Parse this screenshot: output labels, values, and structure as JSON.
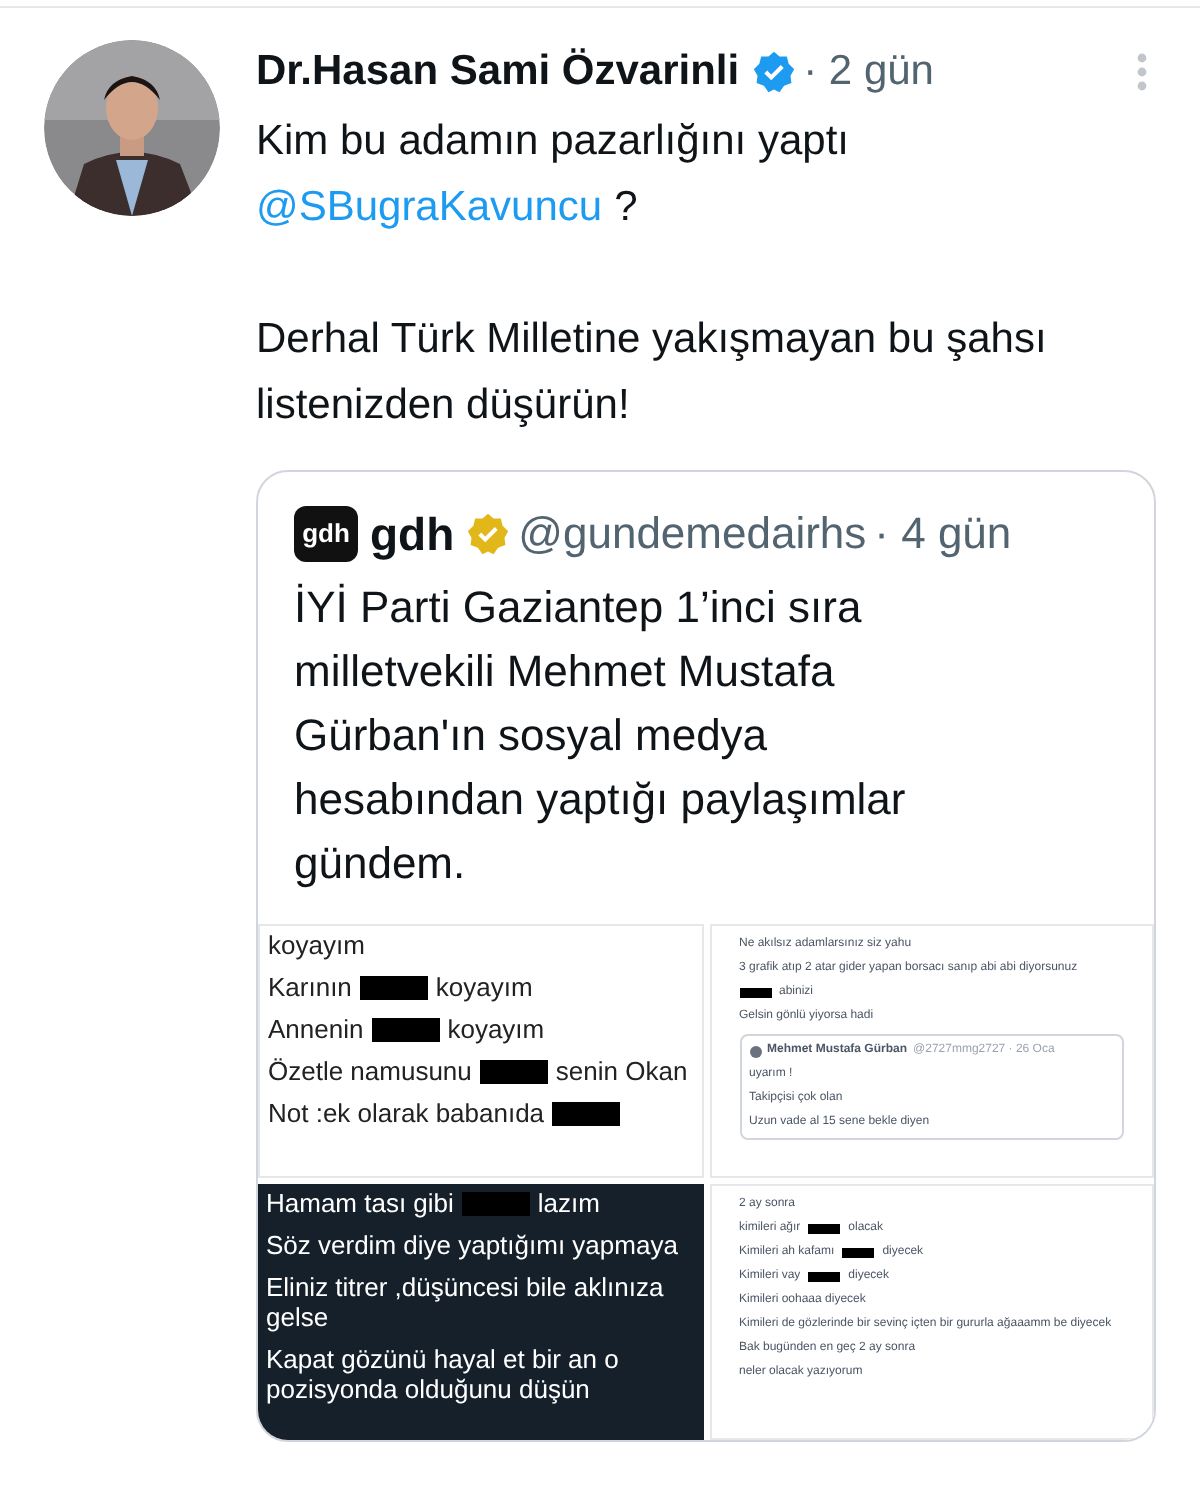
{
  "tweet": {
    "author": "Dr.Hasan Sami Özvarinli",
    "verified": true,
    "time": "· 2 gün",
    "text_lines": [
      {
        "kind": "text",
        "text": "Kim bu adamın pazarlığını yaptı"
      },
      {
        "kind": "mention",
        "text": "@SBugraKavuncu",
        "after": "?"
      },
      {
        "kind": "blank"
      },
      {
        "kind": "text",
        "text": "Derhal Türk Milletine yakışmayan bu şahsı listenizden düşürün!"
      }
    ]
  },
  "quote": {
    "logo": "gdh",
    "author": "gdh",
    "verified": true,
    "handle": "@gundemedairhs",
    "time": "· 4 gün",
    "text": "İYİ Parti Gaziantep 1’inci sıra milletvekili Mehmet Mustafa Gürban'ın sosyal medya hesabından yaptığı paylaşımlar gündem.",
    "images": [
      {
        "kind": "notes",
        "lines": [
          [
            {
              "kind": "text",
              "text": "koyayım"
            }
          ],
          [
            {
              "kind": "text",
              "text": "Karının"
            },
            {
              "kind": "redaction"
            },
            {
              "kind": "text",
              "text": "koyayım"
            }
          ],
          [
            {
              "kind": "text",
              "text": "Annenin"
            },
            {
              "kind": "redaction"
            },
            {
              "kind": "text",
              "text": "koyayım"
            }
          ],
          [
            {
              "kind": "text",
              "text": "Özetle namusunu"
            },
            {
              "kind": "redaction"
            },
            {
              "kind": "text",
              "text": "senin Okan"
            }
          ],
          [
            {
              "kind": "text",
              "text": "Not :ek olarak babanıda"
            },
            {
              "kind": "redaction"
            }
          ]
        ]
      },
      {
        "kind": "thread",
        "lines": [
          [
            {
              "kind": "text",
              "text": "Ne akılsız adamlarsınız siz yahu"
            }
          ],
          [
            {
              "kind": "text",
              "text": "3 grafik atıp 2 atar gider yapan borsacı sanıp abi abi diyorsunuz"
            }
          ],
          [
            {
              "kind": "redaction"
            },
            {
              "kind": "text",
              "text": "abinizi"
            }
          ],
          [
            {
              "kind": "text",
              "text": "Gelsin gönlü yiyorsa hadi"
            }
          ]
        ],
        "quoted": {
          "author": "Mehmet Mustafa Gürban",
          "meta": "@2727mmg2727 · 26 Oca",
          "lines": [
            "uyarım !",
            "Takipçisi çok olan",
            "Uzun vade al 15 sene bekle diyen"
          ]
        }
      },
      {
        "kind": "darknotes",
        "lines": [
          [
            {
              "kind": "text",
              "text": "Hamam tası gibi"
            },
            {
              "kind": "redaction"
            },
            {
              "kind": "text",
              "text": "lazım"
            }
          ],
          [
            {
              "kind": "text",
              "text": "Söz verdim diye yaptığımı yapmaya"
            }
          ],
          [
            {
              "kind": "text",
              "text": "Eliniz titrer ,düşüncesi bile aklınıza gelse"
            }
          ],
          [
            {
              "kind": "text",
              "text": "Kapat gözünü hayal et bir an o pozisyonda olduğunu düşün"
            }
          ]
        ]
      },
      {
        "kind": "thread",
        "lines": [
          [
            {
              "kind": "text",
              "text": "2 ay sonra"
            }
          ],
          [
            {
              "kind": "text",
              "text": "kimileri ağır"
            },
            {
              "kind": "redaction"
            },
            {
              "kind": "text",
              "text": "olacak"
            }
          ],
          [
            {
              "kind": "text",
              "text": "Kimileri ah kafamı"
            },
            {
              "kind": "redaction"
            },
            {
              "kind": "text",
              "text": "diyecek"
            }
          ],
          [
            {
              "kind": "text",
              "text": "Kimileri vay"
            },
            {
              "kind": "redaction"
            },
            {
              "kind": "text",
              "text": "diyecek"
            }
          ],
          [
            {
              "kind": "text",
              "text": "Kimileri oohaaa diyecek"
            }
          ],
          [
            {
              "kind": "text",
              "text": "Kimileri de gözlerinde bir sevinç içten bir gururla ağaaamm be diyecek"
            }
          ],
          [
            {
              "kind": "text",
              "text": "Bak bugünden en geç 2 ay sonra"
            }
          ],
          [
            {
              "kind": "text",
              "text": "neler olacak yazıyorum"
            }
          ]
        ]
      }
    ]
  }
}
